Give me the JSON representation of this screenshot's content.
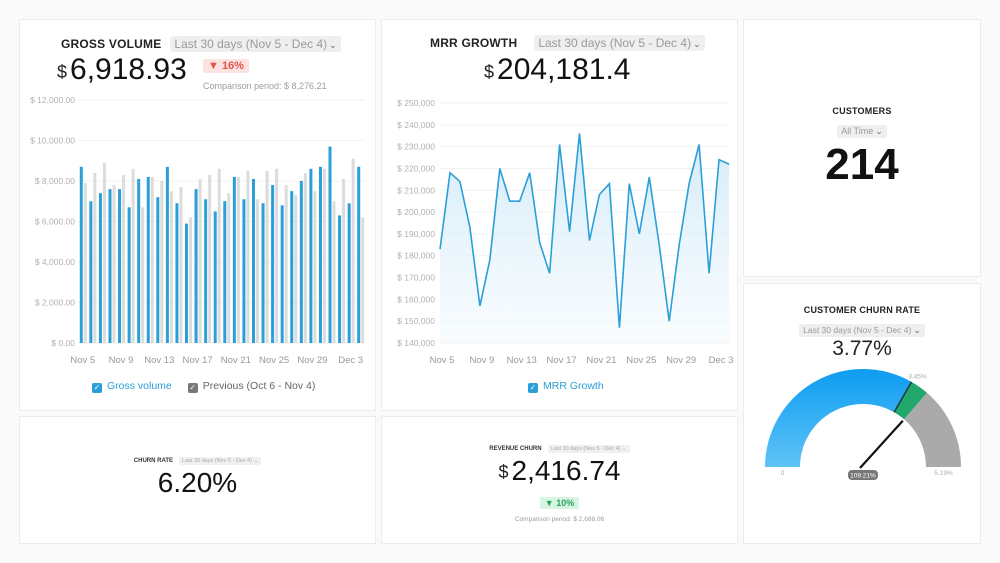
{
  "gross_volume": {
    "title": "GROSS VOLUME",
    "range": "Last 30 days (Nov 5 - Dec 4)",
    "currency": "$",
    "value": "6,918.93",
    "change_badge": "▼ 16%",
    "comparison": "Comparison period: $ 8,276.21",
    "legend": [
      {
        "label": "Gross volume",
        "color": "#2a9fd8"
      },
      {
        "label": "Previous (Oct 6 - Nov 4)",
        "color": "#777777"
      }
    ]
  },
  "mrr_growth": {
    "title": "MRR GROWTH",
    "range": "Last 30 days (Nov 5 - Dec 4)",
    "currency": "$",
    "value": "204,181.4",
    "legend": [
      {
        "label": "MRR Growth",
        "color": "#2a9fd8"
      }
    ]
  },
  "customers": {
    "title": "CUSTOMERS",
    "range": "All Time",
    "value": "214"
  },
  "customer_churn_rate": {
    "title": "CUSTOMER CHURN RATE",
    "range": "Last 30 days (Nov 5 - Dec 4)",
    "value": "3.77%",
    "gauge": {
      "min_label": "0",
      "max_label": "5.19%",
      "target_label": "3.45%",
      "needle_label": "109.21%",
      "min": 0,
      "max": 5.19,
      "value": 3.77,
      "target": 3.45,
      "colors": {
        "fill": "#1aa3f0",
        "band": "#22a86a",
        "rest": "#aaaaaa"
      }
    }
  },
  "churn_rate": {
    "title": "CHURN RATE",
    "range": "Last 30 days (Nov 5 - Dec 4)",
    "value": "6.20%"
  },
  "revenue_churn": {
    "title": "REVENUE CHURN",
    "range": "Last 30 days (Nov 5 - Dec 4)",
    "currency": "$",
    "value": "2,416.74",
    "change_badge": "▼ 10%",
    "comparison": "Comparison period: $ 2,688.06"
  },
  "chart_data": [
    {
      "type": "bar",
      "title": "Gross Volume",
      "ylim": [
        0,
        12000
      ],
      "yticks": [
        "$ 0.00",
        "$ 2,000.00",
        "$ 4,000.00",
        "$ 6,000.00",
        "$ 8,000.00",
        "$ 10,000.00",
        "$ 12,000.00"
      ],
      "ytick_values": [
        0,
        2000,
        4000,
        6000,
        8000,
        10000,
        12000
      ],
      "xtick_labels": [
        "Nov 5",
        "Nov 9",
        "Nov 13",
        "Nov 17",
        "Nov 21",
        "Nov 25",
        "Nov 29",
        "Dec 3"
      ],
      "xtick_index": [
        0,
        4,
        8,
        12,
        16,
        20,
        24,
        28
      ],
      "series": [
        {
          "name": "Gross volume",
          "color": "#2a9fd8",
          "values": [
            8700,
            7000,
            7400,
            7600,
            7600,
            6700,
            8100,
            8200,
            7200,
            8700,
            6900,
            5900,
            7600,
            7100,
            6500,
            7000,
            8200,
            7100,
            8100,
            6900,
            7800,
            6800,
            7500,
            8000,
            8600,
            8700,
            9700,
            6300,
            6900,
            8700
          ]
        },
        {
          "name": "Previous (Oct 6 - Nov 4)",
          "color": "#dcdcdc",
          "values": [
            7900,
            8400,
            8900,
            7800,
            8300,
            8600,
            6700,
            8200,
            8000,
            7500,
            7700,
            6200,
            8100,
            8300,
            8600,
            7400,
            8200,
            8500,
            7100,
            8500,
            8600,
            7800,
            7300,
            8400,
            7500,
            8600,
            7000,
            8100,
            9100,
            6200
          ]
        }
      ]
    },
    {
      "type": "area",
      "title": "MRR Growth",
      "ylim": [
        140000,
        250000
      ],
      "yticks": [
        "$ 140,000",
        "$ 150,000",
        "$ 160,000",
        "$ 170,000",
        "$ 180,000",
        "$ 190,000",
        "$ 200,000",
        "$ 210,000",
        "$ 220,000",
        "$ 230,000",
        "$ 240,000",
        "$ 250,000"
      ],
      "ytick_values": [
        140000,
        150000,
        160000,
        170000,
        180000,
        190000,
        200000,
        210000,
        220000,
        230000,
        240000,
        250000
      ],
      "xtick_labels": [
        "Nov 5",
        "Nov 9",
        "Nov 13",
        "Nov 17",
        "Nov 21",
        "Nov 25",
        "Nov 29",
        "Dec 3"
      ],
      "xtick_index": [
        0,
        4,
        8,
        12,
        16,
        20,
        24,
        28
      ],
      "series": [
        {
          "name": "MRR Growth",
          "color": "#2a9fd8",
          "values": [
            183000,
            218000,
            214000,
            193000,
            157000,
            178000,
            220000,
            205000,
            205000,
            218000,
            186000,
            172000,
            231000,
            191000,
            236000,
            187000,
            208000,
            213000,
            147000,
            213000,
            190000,
            216000,
            185000,
            150000,
            185000,
            213000,
            231000,
            172000,
            224000,
            222000
          ]
        }
      ]
    }
  ]
}
